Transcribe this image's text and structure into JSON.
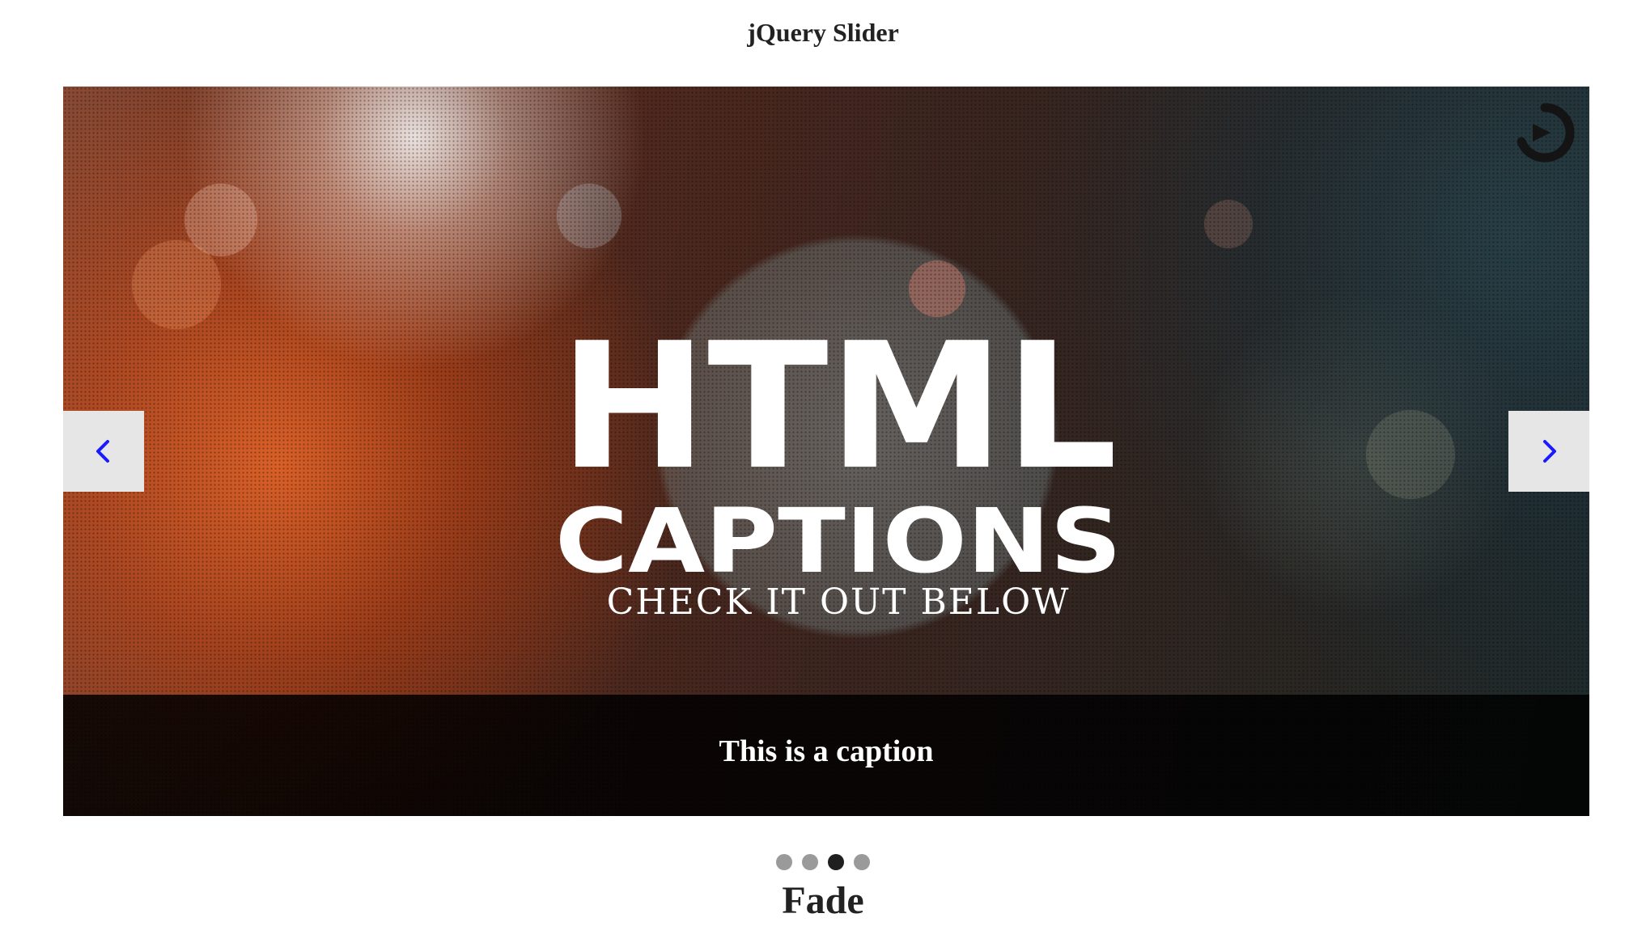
{
  "page": {
    "title": "jQuery Slider"
  },
  "slider": {
    "slide_heading_line1": "HTML",
    "slide_heading_line2": "CAPTIONS",
    "slide_subtitle": "CHECK IT OUT BELOW",
    "caption": "This is a caption",
    "prev_icon": "chevron-left-icon",
    "next_icon": "chevron-right-icon",
    "accent_color": "#1a1aff",
    "pager": {
      "count": 4,
      "active_index": 2
    }
  },
  "section": {
    "heading": "Fade"
  }
}
